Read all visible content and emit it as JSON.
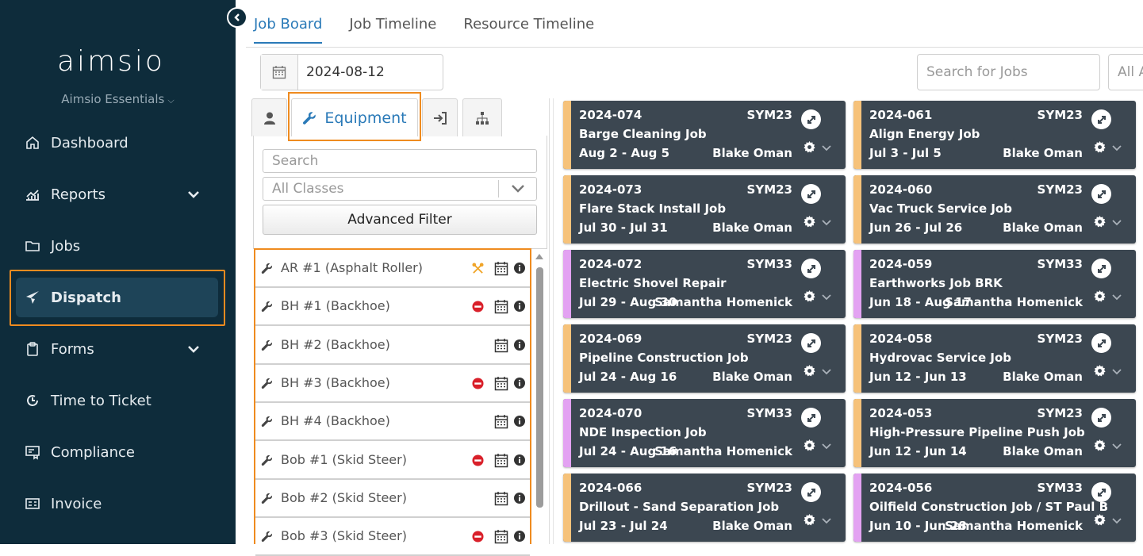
{
  "sidebar": {
    "logo": "aimsio",
    "edition": "Aimsio Essentials",
    "items": [
      {
        "label": "Dashboard",
        "icon": "home-icon"
      },
      {
        "label": "Reports",
        "icon": "chart-icon"
      },
      {
        "label": "Jobs",
        "icon": "folder-icon"
      },
      {
        "label": "Dispatch",
        "icon": "paper-plane-icon"
      },
      {
        "label": "Forms",
        "icon": "clipboard-icon"
      },
      {
        "label": "Time to Ticket",
        "icon": "clock-icon"
      },
      {
        "label": "Compliance",
        "icon": "compliance-icon"
      },
      {
        "label": "Invoice",
        "icon": "invoice-icon"
      }
    ]
  },
  "tabs": [
    "Job Board",
    "Job Timeline",
    "Resource Timeline"
  ],
  "toolbar": {
    "date": "2024-08-12",
    "search_placeholder": "Search for Jobs",
    "all_dropdown": "All A"
  },
  "resource_panel": {
    "active_tab": "Equipment",
    "search_placeholder": "Search",
    "class_placeholder": "All Classes",
    "advanced_filter": "Advanced Filter",
    "equipment": [
      {
        "name": "AR #1 (Asphalt Roller)",
        "status": "maintenance"
      },
      {
        "name": "BH #1 (Backhoe)",
        "status": "unavailable"
      },
      {
        "name": "BH #2 (Backhoe)",
        "status": "none"
      },
      {
        "name": "BH #3 (Backhoe)",
        "status": "unavailable"
      },
      {
        "name": "BH #4 (Backhoe)",
        "status": "none"
      },
      {
        "name": "Bob #1 (Skid Steer)",
        "status": "unavailable"
      },
      {
        "name": "Bob #2 (Skid Steer)",
        "status": "none"
      },
      {
        "name": "Bob #3 (Skid Steer)",
        "status": "unavailable"
      }
    ]
  },
  "colors": {
    "sidebar_bg": "#0e2c3b",
    "accent": "#2a7ab8",
    "highlight": "#ef8b1f",
    "card_bg": "#3c4751",
    "stripe_orange": "#f6c27a",
    "stripe_purple": "#e3a2f2"
  },
  "jobs": [
    {
      "number": "2024-074",
      "code": "SYM23",
      "title": "Barge Cleaning Job",
      "dates": "Aug 2 - Aug 5",
      "person": "Blake Oman",
      "stripe": "orange"
    },
    {
      "number": "2024-061",
      "code": "SYM23",
      "title": "Align Energy Job",
      "dates": "Jul 3 - Jul 5",
      "person": "Blake Oman",
      "stripe": "orange"
    },
    {
      "number": "2024-073",
      "code": "SYM23",
      "title": "Flare Stack Install Job",
      "dates": "Jul 30 - Jul 31",
      "person": "Blake Oman",
      "stripe": "orange"
    },
    {
      "number": "2024-060",
      "code": "SYM23",
      "title": "Vac Truck Service Job",
      "dates": "Jun 26 - Jul 26",
      "person": "Blake Oman",
      "stripe": "orange"
    },
    {
      "number": "2024-072",
      "code": "SYM33",
      "title": "Electric Shovel Repair",
      "dates": "Jul 29 - Aug 30",
      "person": "Samantha Homenick",
      "stripe": "purple"
    },
    {
      "number": "2024-059",
      "code": "SYM33",
      "title": "Earthworks Job BRK",
      "dates": "Jun 18 - Aug 17",
      "person": "Samantha Homenick",
      "stripe": "purple"
    },
    {
      "number": "2024-069",
      "code": "SYM23",
      "title": "Pipeline Construction Job",
      "dates": "Jul 24 - Aug 16",
      "person": "Blake Oman",
      "stripe": "orange"
    },
    {
      "number": "2024-058",
      "code": "SYM23",
      "title": "Hydrovac Service Job",
      "dates": "Jun 12 - Jun 13",
      "person": "Blake Oman",
      "stripe": "orange"
    },
    {
      "number": "2024-070",
      "code": "SYM33",
      "title": "NDE Inspection Job",
      "dates": "Jul 24 - Aug 16",
      "person": "Samantha Homenick",
      "stripe": "purple"
    },
    {
      "number": "2024-053",
      "code": "SYM23",
      "title": "High-Pressure Pipeline Push Job",
      "dates": "Jun 12 - Jun 14",
      "person": "Blake Oman",
      "stripe": "orange"
    },
    {
      "number": "2024-066",
      "code": "SYM23",
      "title": "Drillout - Sand Separation Job",
      "dates": "Jul 23 - Jul 24",
      "person": "Blake Oman",
      "stripe": "orange"
    },
    {
      "number": "2024-056",
      "code": "SYM33",
      "title": "Oilfield Construction Job / ST Paul B...",
      "dates": "Jun 10 - Jun 28",
      "person": "Samantha Homenick",
      "stripe": "purple"
    }
  ]
}
